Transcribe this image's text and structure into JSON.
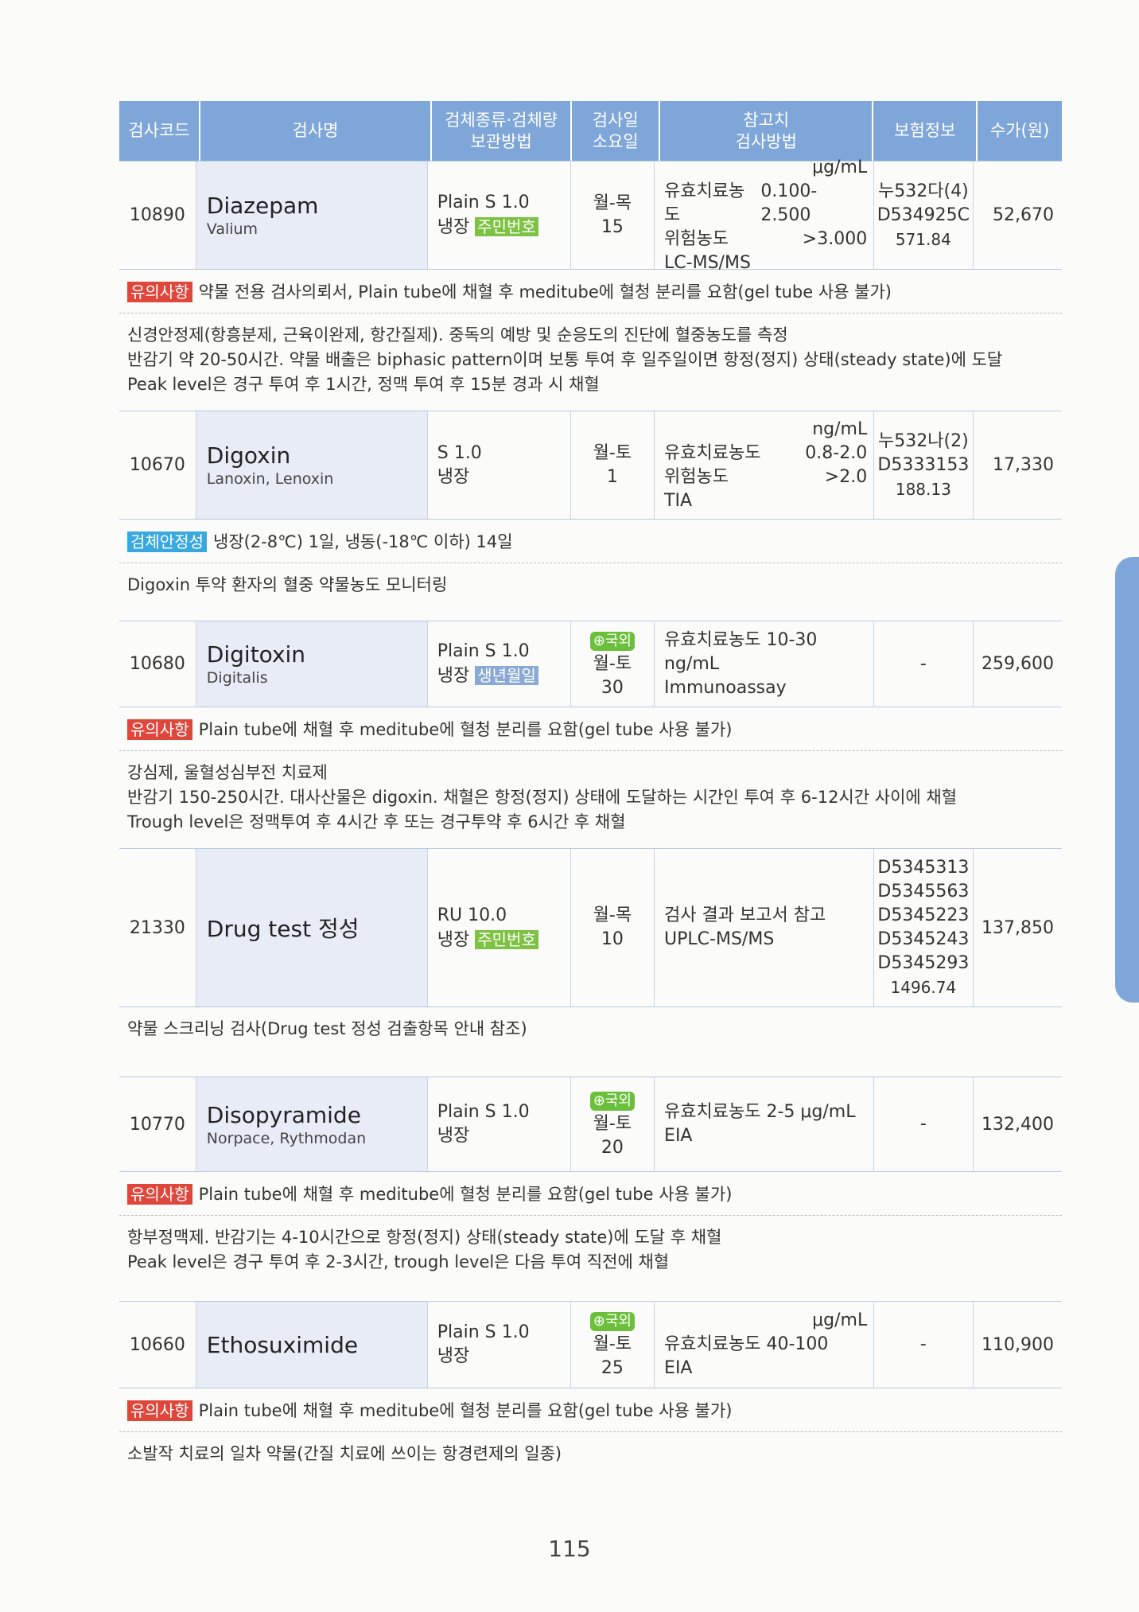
{
  "header": [
    "검사코드",
    "검사명",
    "검체종류·검체량\n보관방법",
    "검사일\n소요일",
    "참고치\n검사방법",
    "보험정보",
    "수가(원)"
  ],
  "items": [
    {
      "code": "10890",
      "name": "Diazepam",
      "sub": "Valium",
      "spec1": "Plain S 1.0",
      "spec2": "냉장",
      "tag": "주민번호",
      "days1": "월-목",
      "days2": "15",
      "unit": "μg/mL",
      "ref": [
        [
          "유효치료농도",
          "0.100-2.500"
        ],
        [
          "위험농도",
          ">3.000"
        ]
      ],
      "method": "LC-MS/MS",
      "ins": [
        "누532다(4)",
        "D534925C",
        "571.84"
      ],
      "price": "52,670",
      "note_tag": "유의사항",
      "note": "약물 전용 검사의뢰서, Plain tube에 채혈 후 meditube에 혈청 분리를 요함(gel tube 사용 불가)",
      "desc": [
        "신경안정제(항흥분제, 근육이완제, 항간질제). 중독의 예방 및 순응도의 진단에 혈중농도를 측정",
        "반감기 약 20-50시간. 약물 배출은 biphasic pattern이며 보통 투여 후 일주일이면 항정(정지) 상태(steady state)에 도달",
        "Peak level은 경구 투여 후 1시간, 정맥 투여 후 15분 경과 시 채혈"
      ]
    },
    {
      "code": "10670",
      "name": "Digoxin",
      "sub": "Lanoxin, Lenoxin",
      "spec1": "S 1.0",
      "spec2": "냉장",
      "tag": "",
      "days1": "월-토",
      "days2": "1",
      "unit": "ng/mL",
      "ref": [
        [
          "유효치료농도",
          "0.8-2.0"
        ],
        [
          "위험농도",
          ">2.0"
        ]
      ],
      "method": "TIA",
      "ins": [
        "누532나(2)",
        "D5333153",
        "188.13"
      ],
      "price": "17,330",
      "note_tag": "검체안정성",
      "note": "냉장(2-8℃) 1일, 냉동(-18℃ 이하) 14일",
      "desc": [
        "Digoxin 투약 환자의 혈중 약물농도 모니터링"
      ]
    },
    {
      "code": "10680",
      "name": "Digitoxin",
      "sub": "Digitalis",
      "spec1": "Plain S 1.0",
      "spec2": "냉장",
      "tag": "생년월일",
      "globe": "국외",
      "days1": "월-토",
      "days2": "30",
      "ref_line": "유효치료농도 10-30 ng/mL",
      "method": "Immunoassay",
      "ins_dash": "-",
      "price": "259,600",
      "note_tag": "유의사항",
      "note": "Plain tube에 채혈 후 meditube에 혈청 분리를 요함(gel tube 사용 불가)",
      "desc": [
        "강심제, 울혈성심부전 치료제",
        "반감기 150-250시간. 대사산물은 digoxin. 채혈은 항정(정지) 상태에 도달하는 시간인 투여 후 6-12시간 사이에 채혈",
        "Trough level은 정맥투여 후 4시간 후 또는 경구투약 후 6시간 후 채혈"
      ]
    },
    {
      "code": "21330",
      "name": "Drug test 정성",
      "spec1": "RU 10.0",
      "spec2": "냉장",
      "tag": "주민번호",
      "days1": "월-목",
      "days2": "10",
      "ref_line": "검사 결과 보고서 참고",
      "method": "UPLC-MS/MS",
      "ins": [
        "D5345313",
        "D5345563",
        "D5345223",
        "D5345243",
        "D5345293",
        "1496.74"
      ],
      "price": "137,850",
      "desc": [
        "약물 스크리닝 검사(Drug test 정성 검출항목 안내 참조)"
      ]
    },
    {
      "code": "10770",
      "name": "Disopyramide",
      "sub": "Norpace, Rythmodan",
      "spec1": "Plain S 1.0",
      "spec2": "냉장",
      "globe": "국외",
      "days1": "월-토",
      "days2": "20",
      "ref_line": "유효치료농도   2-5 μg/mL",
      "method": "EIA",
      "ins_dash": "-",
      "price": "132,400",
      "note_tag": "유의사항",
      "note": "Plain tube에 채혈 후 meditube에 혈청 분리를 요함(gel tube 사용 불가)",
      "desc": [
        "항부정맥제. 반감기는 4-10시간으로 항정(정지) 상태(steady state)에 도달 후 채혈",
        "Peak level은 경구 투여 후 2-3시간, trough level은 다음 투여 직전에 채혈"
      ]
    },
    {
      "code": "10660",
      "name": "Ethosuximide",
      "spec1": "Plain S 1.0",
      "spec2": "냉장",
      "globe": "국외",
      "days1": "월-토",
      "days2": "25",
      "unit": "μg/mL",
      "ref_line": "유효치료농도 40-100",
      "method": "EIA",
      "ins_dash": "-",
      "price": "110,900",
      "note_tag": "유의사항",
      "note": "Plain tube에 채혈 후 meditube에 혈청 분리를 요함(gel tube 사용 불가)",
      "desc": [
        "소발작 치료의 일차 약물(간질 치료에 쓰이는 항경련제의 일종)"
      ]
    }
  ],
  "page_number": "115"
}
